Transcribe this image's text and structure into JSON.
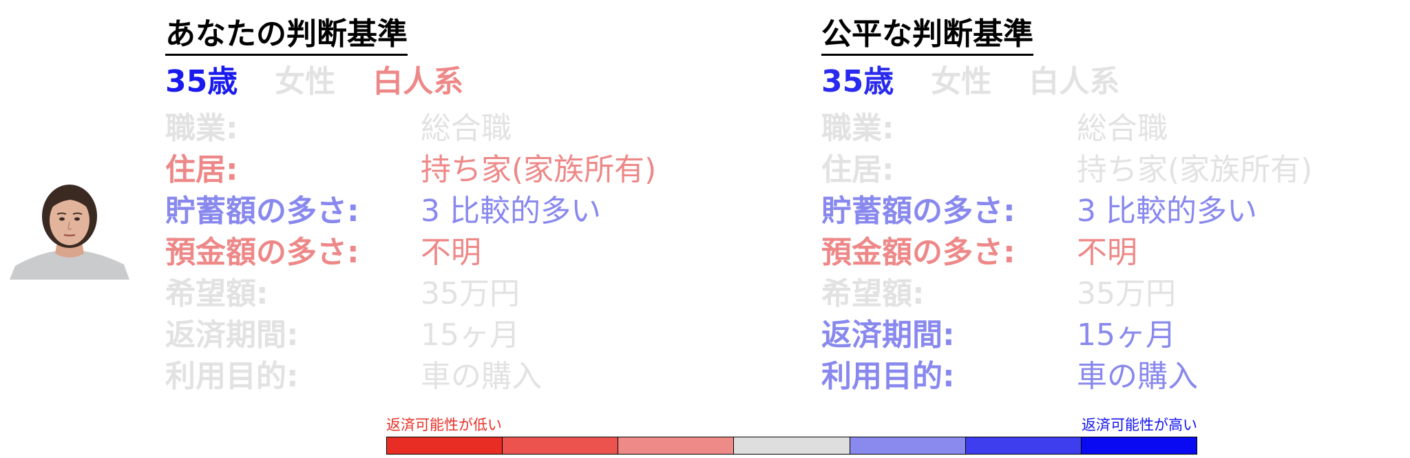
{
  "colors": {
    "gray": "#e2e2e2",
    "red": "#ee8888",
    "blue": "#8888ee",
    "blue_strong": "#2222ee",
    "red_strong": "#e82e24",
    "scale": [
      "#e82e24",
      "#ec534f",
      "#ee8a88",
      "#dedede",
      "#8a8aee",
      "#3e3eee",
      "#0a0af2"
    ]
  },
  "yours": {
    "title": "あなたの判断基準",
    "demographics": [
      {
        "text": "35歳",
        "color": "#1a1aee"
      },
      {
        "text": "女性",
        "color": "#e2e2e2"
      },
      {
        "text": "白人系",
        "color": "#ee8888"
      }
    ],
    "rows": [
      {
        "label": "職業:",
        "value": "総合職",
        "color": "#e2e2e2"
      },
      {
        "label": "住居:",
        "value": "持ち家(家族所有)",
        "color": "#ee8888"
      },
      {
        "label": "貯蓄額の多さ:",
        "value": "3 比較的多い",
        "color": "#8888ee"
      },
      {
        "label": "預金額の多さ:",
        "value": "不明",
        "color": "#ee8888"
      },
      {
        "label": "希望額:",
        "value": "35万円",
        "color": "#e2e2e2"
      },
      {
        "label": "返済期間:",
        "value": "15ヶ月",
        "color": "#e2e2e2"
      },
      {
        "label": "利用目的:",
        "value": "車の購入",
        "color": "#e2e2e2"
      }
    ]
  },
  "fair": {
    "title": "公平な判断基準",
    "demographics": [
      {
        "text": "35歳",
        "color": "#2a2aee"
      },
      {
        "text": "女性",
        "color": "#e2e2e2"
      },
      {
        "text": "白人系",
        "color": "#e2e2e2"
      }
    ],
    "rows": [
      {
        "label": "職業:",
        "value": "総合職",
        "color": "#e2e2e2"
      },
      {
        "label": "住居:",
        "value": "持ち家(家族所有)",
        "color": "#e2e2e2"
      },
      {
        "label": "貯蓄額の多さ:",
        "value": "3 比較的多い",
        "color": "#8888ee"
      },
      {
        "label": "預金額の多さ:",
        "value": "不明",
        "color": "#ee8888"
      },
      {
        "label": "希望額:",
        "value": "35万円",
        "color": "#e2e2e2"
      },
      {
        "label": "返済期間:",
        "value": "15ヶ月",
        "color": "#8888ee"
      },
      {
        "label": "利用目的:",
        "value": "車の購入",
        "color": "#8888ee"
      }
    ]
  },
  "legend": {
    "low_label": "返済可能性が低い",
    "high_label": "返済可能性が高い"
  },
  "avatar": {
    "icon": "person-portrait-icon"
  }
}
